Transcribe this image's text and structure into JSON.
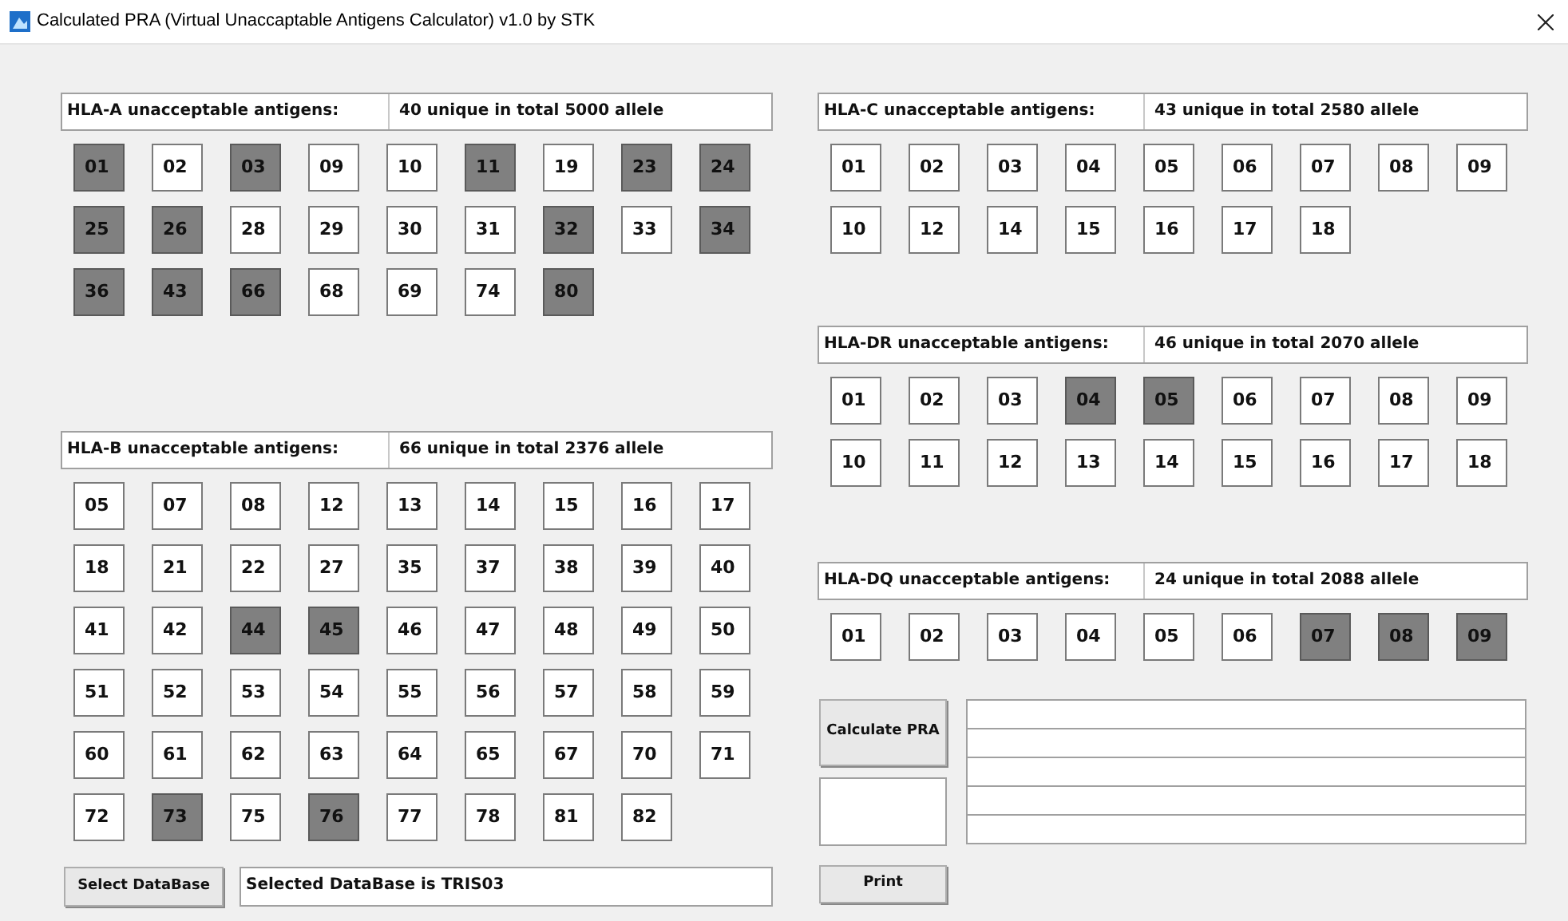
{
  "window": {
    "title": "Calculated PRA (Virtual Unaccaptable Antigens Calculator) v1.0 by STK"
  },
  "left_sections": [
    {
      "label": "HLA-A unacceptable antigens:",
      "summary": "40 unique in total 5000 allele",
      "antigens": [
        {
          "label": "01",
          "selected": true
        },
        {
          "label": "02",
          "selected": false
        },
        {
          "label": "03",
          "selected": true
        },
        {
          "label": "09",
          "selected": false
        },
        {
          "label": "10",
          "selected": false
        },
        {
          "label": "11",
          "selected": true
        },
        {
          "label": "19",
          "selected": false
        },
        {
          "label": "23",
          "selected": true
        },
        {
          "label": "24",
          "selected": true
        },
        {
          "label": "25",
          "selected": true
        },
        {
          "label": "26",
          "selected": true
        },
        {
          "label": "28",
          "selected": false
        },
        {
          "label": "29",
          "selected": false
        },
        {
          "label": "30",
          "selected": false
        },
        {
          "label": "31",
          "selected": false
        },
        {
          "label": "32",
          "selected": true
        },
        {
          "label": "33",
          "selected": false
        },
        {
          "label": "34",
          "selected": true
        },
        {
          "label": "36",
          "selected": true
        },
        {
          "label": "43",
          "selected": true
        },
        {
          "label": "66",
          "selected": true
        },
        {
          "label": "68",
          "selected": false
        },
        {
          "label": "69",
          "selected": false
        },
        {
          "label": "74",
          "selected": false
        },
        {
          "label": "80",
          "selected": true
        }
      ]
    },
    {
      "label": "HLA-B unacceptable antigens:",
      "summary": "66 unique in total 2376 allele",
      "antigens": [
        {
          "label": "05",
          "selected": false
        },
        {
          "label": "07",
          "selected": false
        },
        {
          "label": "08",
          "selected": false
        },
        {
          "label": "12",
          "selected": false
        },
        {
          "label": "13",
          "selected": false
        },
        {
          "label": "14",
          "selected": false
        },
        {
          "label": "15",
          "selected": false
        },
        {
          "label": "16",
          "selected": false
        },
        {
          "label": "17",
          "selected": false
        },
        {
          "label": "18",
          "selected": false
        },
        {
          "label": "21",
          "selected": false
        },
        {
          "label": "22",
          "selected": false
        },
        {
          "label": "27",
          "selected": false
        },
        {
          "label": "35",
          "selected": false
        },
        {
          "label": "37",
          "selected": false
        },
        {
          "label": "38",
          "selected": false
        },
        {
          "label": "39",
          "selected": false
        },
        {
          "label": "40",
          "selected": false
        },
        {
          "label": "41",
          "selected": false
        },
        {
          "label": "42",
          "selected": false
        },
        {
          "label": "44",
          "selected": true
        },
        {
          "label": "45",
          "selected": true
        },
        {
          "label": "46",
          "selected": false
        },
        {
          "label": "47",
          "selected": false
        },
        {
          "label": "48",
          "selected": false
        },
        {
          "label": "49",
          "selected": false
        },
        {
          "label": "50",
          "selected": false
        },
        {
          "label": "51",
          "selected": false
        },
        {
          "label": "52",
          "selected": false
        },
        {
          "label": "53",
          "selected": false
        },
        {
          "label": "54",
          "selected": false
        },
        {
          "label": "55",
          "selected": false
        },
        {
          "label": "56",
          "selected": false
        },
        {
          "label": "57",
          "selected": false
        },
        {
          "label": "58",
          "selected": false
        },
        {
          "label": "59",
          "selected": false
        },
        {
          "label": "60",
          "selected": false
        },
        {
          "label": "61",
          "selected": false
        },
        {
          "label": "62",
          "selected": false
        },
        {
          "label": "63",
          "selected": false
        },
        {
          "label": "64",
          "selected": false
        },
        {
          "label": "65",
          "selected": false
        },
        {
          "label": "67",
          "selected": false
        },
        {
          "label": "70",
          "selected": false
        },
        {
          "label": "71",
          "selected": false
        },
        {
          "label": "72",
          "selected": false
        },
        {
          "label": "73",
          "selected": true
        },
        {
          "label": "75",
          "selected": false
        },
        {
          "label": "76",
          "selected": true
        },
        {
          "label": "77",
          "selected": false
        },
        {
          "label": "78",
          "selected": false
        },
        {
          "label": "81",
          "selected": false
        },
        {
          "label": "82",
          "selected": false
        }
      ]
    }
  ],
  "right_sections": [
    {
      "label": "HLA-C unacceptable antigens:",
      "summary": "43 unique in total 2580 allele",
      "antigens": [
        {
          "label": "01",
          "selected": false
        },
        {
          "label": "02",
          "selected": false
        },
        {
          "label": "03",
          "selected": false
        },
        {
          "label": "04",
          "selected": false
        },
        {
          "label": "05",
          "selected": false
        },
        {
          "label": "06",
          "selected": false
        },
        {
          "label": "07",
          "selected": false
        },
        {
          "label": "08",
          "selected": false
        },
        {
          "label": "09",
          "selected": false
        },
        {
          "label": "10",
          "selected": false
        },
        {
          "label": "12",
          "selected": false
        },
        {
          "label": "14",
          "selected": false
        },
        {
          "label": "15",
          "selected": false
        },
        {
          "label": "16",
          "selected": false
        },
        {
          "label": "17",
          "selected": false
        },
        {
          "label": "18",
          "selected": false
        }
      ]
    },
    {
      "label": "HLA-DR unacceptable antigens:",
      "summary": "46 unique in total 2070 allele",
      "antigens": [
        {
          "label": "01",
          "selected": false
        },
        {
          "label": "02",
          "selected": false
        },
        {
          "label": "03",
          "selected": false
        },
        {
          "label": "04",
          "selected": true
        },
        {
          "label": "05",
          "selected": true
        },
        {
          "label": "06",
          "selected": false
        },
        {
          "label": "07",
          "selected": false
        },
        {
          "label": "08",
          "selected": false
        },
        {
          "label": "09",
          "selected": false
        },
        {
          "label": "10",
          "selected": false
        },
        {
          "label": "11",
          "selected": false
        },
        {
          "label": "12",
          "selected": false
        },
        {
          "label": "13",
          "selected": false
        },
        {
          "label": "14",
          "selected": false
        },
        {
          "label": "15",
          "selected": false
        },
        {
          "label": "16",
          "selected": false
        },
        {
          "label": "17",
          "selected": false
        },
        {
          "label": "18",
          "selected": false
        }
      ]
    },
    {
      "label": "HLA-DQ unacceptable antigens:",
      "summary": "24 unique in total 2088 allele",
      "antigens": [
        {
          "label": "01",
          "selected": false
        },
        {
          "label": "02",
          "selected": false
        },
        {
          "label": "03",
          "selected": false
        },
        {
          "label": "04",
          "selected": false
        },
        {
          "label": "05",
          "selected": false
        },
        {
          "label": "06",
          "selected": false
        },
        {
          "label": "07",
          "selected": true
        },
        {
          "label": "08",
          "selected": true
        },
        {
          "label": "09",
          "selected": true
        }
      ]
    }
  ],
  "select_database_button": "Select DataBase",
  "database_status": "Selected DataBase is TRIS03",
  "calculate_button": "Calculate PRA",
  "print_button": "Print"
}
